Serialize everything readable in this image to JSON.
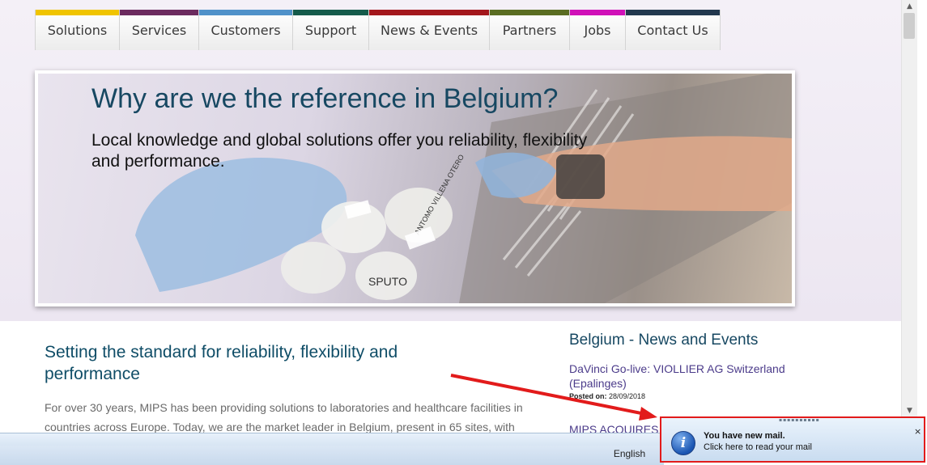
{
  "nav": {
    "items": [
      {
        "label": "Solutions",
        "color": "#f0c400"
      },
      {
        "label": "Services",
        "color": "#6b2a5e"
      },
      {
        "label": "Customers",
        "color": "#4f91c9"
      },
      {
        "label": "Support",
        "color": "#145a4a"
      },
      {
        "label": "News & Events",
        "color": "#a3171c"
      },
      {
        "label": "Partners",
        "color": "#5a6d22"
      },
      {
        "label": "Jobs",
        "color": "#d010b8"
      },
      {
        "label": "Contact Us",
        "color": "#22384e"
      }
    ]
  },
  "hero": {
    "title": "Why are we the reference in Belgium?",
    "subtitle": "Local knowledge and global solutions offer you reliability, flexibility and performance.",
    "image_labels": [
      "SPUTO",
      "ANTOMO VILLENA OTERO"
    ]
  },
  "content": {
    "heading": "Setting the standard for reliability, flexibility and performance",
    "body": "For over 30 years, MIPS has been providing solutions to laboratories and healthcare facilities in countries across Europe. Today, we are the market leader in Belgium, present in 65 sites, with"
  },
  "news": {
    "title": "Belgium - News and Events",
    "items": [
      {
        "link": "DaVinci Go-live: VIOLLIER AG Switzerland (Epalinges)",
        "posted_label": "Posted on:",
        "posted_date": "28/09/2018"
      },
      {
        "link": "MIPS ACQUIRES"
      }
    ]
  },
  "statusbar": {
    "language": "English"
  },
  "notification": {
    "title": "You have new mail.",
    "subtitle": "Click here to read your mail",
    "close": "×",
    "icon_letter": "i"
  },
  "colors": {
    "heading": "#174862",
    "link": "#4b3b8a",
    "annotation": "#e21b1b"
  }
}
